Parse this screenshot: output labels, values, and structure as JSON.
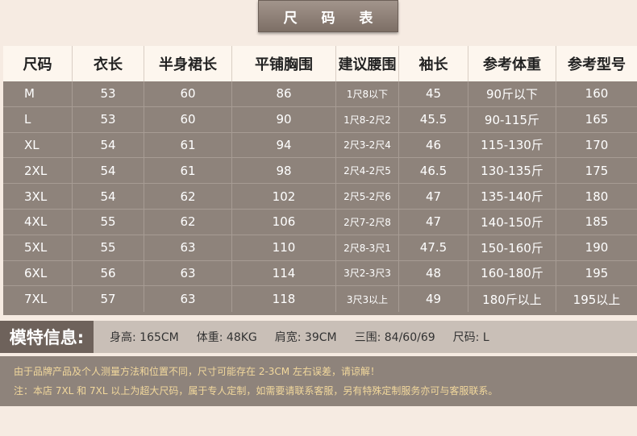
{
  "title": "尺 码 表",
  "table": {
    "headers": [
      "尺码",
      "衣长",
      "半身裙长",
      "平铺胸围",
      "建议腰围",
      "袖长",
      "参考体重",
      "参考型号"
    ],
    "rows": [
      [
        "M",
        "53",
        "60",
        "86",
        "1尺8以下",
        "45",
        "90斤以下",
        "160"
      ],
      [
        "L",
        "53",
        "60",
        "90",
        "1尺8-2尺2",
        "45.5",
        "90-115斤",
        "165"
      ],
      [
        "XL",
        "54",
        "61",
        "94",
        "2尺3-2尺4",
        "46",
        "115-130斤",
        "170"
      ],
      [
        "2XL",
        "54",
        "61",
        "98",
        "2尺4-2尺5",
        "46.5",
        "130-135斤",
        "175"
      ],
      [
        "3XL",
        "54",
        "62",
        "102",
        "2尺5-2尺6",
        "47",
        "135-140斤",
        "180"
      ],
      [
        "4XL",
        "55",
        "62",
        "106",
        "2尺7-2尺8",
        "47",
        "140-150斤",
        "185"
      ],
      [
        "5XL",
        "55",
        "63",
        "110",
        "2尺8-3尺1",
        "47.5",
        "150-160斤",
        "190"
      ],
      [
        "6XL",
        "56",
        "63",
        "114",
        "3尺2-3尺3",
        "48",
        "160-180斤",
        "195"
      ],
      [
        "7XL",
        "57",
        "63",
        "118",
        "3尺3以上",
        "49",
        "180斤以上",
        "195以上"
      ]
    ]
  },
  "model": {
    "label": "模特信息:",
    "height": "身高: 165CM",
    "weight": "体重: 48KG",
    "shoulder": "肩宽: 39CM",
    "measurements": "三围: 84/60/69",
    "size": "尺码: L"
  },
  "notes": {
    "line1": "由于品牌产品及个人测量方法和位置不同，尺寸可能存在 2-3CM 左右误差，请谅解！",
    "line2": "注：本店 7XL 和 7XL 以上为超大尺码，属于专人定制，如需要请联系客服，另有特殊定制服务亦可与客服联系。"
  },
  "colors": {
    "table_bg": "#8e837b",
    "header_bg": "#fdf6ee",
    "note_text": "#f2d89c",
    "page_bg": "#f6ebe2"
  }
}
